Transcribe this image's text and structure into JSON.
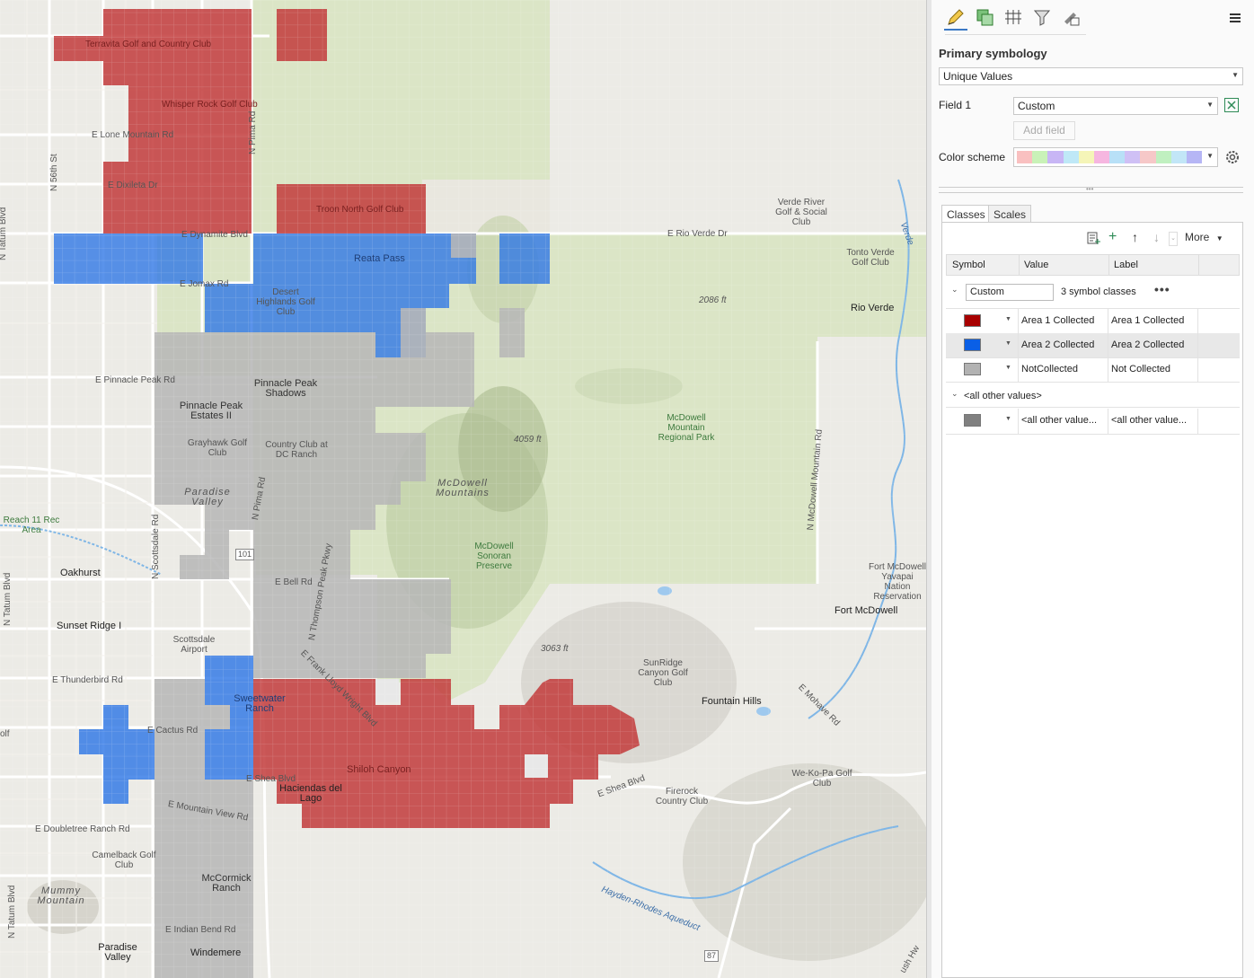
{
  "map": {
    "labels": {
      "terravita": "Terravita Golf and Country Club",
      "whisper_rock": "Whisper Rock Golf Club",
      "lone_mountain": "E Lone Mountain Rd",
      "dixileta": "E Dixileta Dr",
      "n56th": "N 56th St",
      "n_pima_top": "N Pima Rd",
      "n_tatum_top": "N Tatum Blvd",
      "troon": "Troon North Golf Club",
      "dynamite": "E Dynamite Blvd",
      "rio_verde_dr": "E Rio Verde Dr",
      "reata": "Reata Pass",
      "jomax": "E Jomax Rd",
      "desert_highlands": "Desert Highlands Golf Club",
      "verde_river_golf": "Verde River Golf & Social Club",
      "tonto_verde": "Tonto Verde Golf Club",
      "rio_verde": "Rio Verde",
      "elev_2086": "2086 ft",
      "verde_river": "Verde",
      "pinnacle_peak_rd": "E Pinnacle Peak Rd",
      "pinnacle_peak_shadows": "Pinnacle Peak Shadows",
      "pinnacle_peak_estates": "Pinnacle Peak Estates II",
      "grayhawk": "Grayhawk Golf Club",
      "country_club_dc": "Country Club at DC Ranch",
      "paradise_valley_italic": "Paradise Valley",
      "n_pima_mid": "N Pima Rd",
      "elev_4059": "4059 ft",
      "mcdowell_mountains": "McDowell Mountains",
      "mcdowell_park": "McDowell Mountain Regional Park",
      "mcdowell_mtn_rd": "N McDowell Mountain Rd",
      "mcdowell_sonoran": "McDowell Sonoran Preserve",
      "reach11": "Reach 11 Rec Area",
      "scottsdale_rd": "N Scottsdale Rd",
      "oakhurst": "Oakhurst",
      "hwy101": "101",
      "bell_rd": "E Bell Rd",
      "thompson_peak": "N Thompson Peak Pkwy",
      "tatum_mid": "N Tatum Blvd",
      "sunset_ridge": "Sunset Ridge I",
      "scottsdale_airport": "Scottsdale Airport",
      "fort_mcdowell_res": "Fort McDowell Yavapai Nation Reservation",
      "fort_mcdowell": "Fort McDowell",
      "elev_3063": "3063 ft",
      "sunridge": "SunRidge Canyon Golf Club",
      "frank_lloyd": "E Frank Lloyd Wright Blvd",
      "thunderbird": "E Thunderbird Rd",
      "sweetwater": "Sweetwater Ranch",
      "fountain_hills": "Fountain Hills",
      "mohave": "E Mohave Rd",
      "cactus": "E Cactus Rd",
      "shea_left": "E Shea Blvd",
      "shiloh": "Shiloh Canyon",
      "haciendas": "Haciendas del Lago",
      "wekopa": "We-Ko-Pa Golf Club",
      "shea_right": "E Shea Blvd",
      "firerock": "Firerock Country Club",
      "mountain_view": "E Mountain View Rd",
      "doubletree": "E Doubletree Ranch Rd",
      "camelback": "Camelback Golf Club",
      "mccormick": "McCormick Ranch",
      "mummy": "Mummy Mountain",
      "tatum_low": "N Tatum Blvd",
      "indian_bend": "E Indian Bend Rd",
      "paradise_valley": "Paradise Valley",
      "windemere": "Windemere",
      "hayden": "Hayden-Rhodes Aqueduct",
      "hwy87": "87",
      "olf": "olf",
      "ush": "ush Hw"
    }
  },
  "panel": {
    "tool_icons": [
      "symbology-pen-icon",
      "vary-symbology-icon",
      "label-grid-icon",
      "filter-icon",
      "attribute-pen-icon"
    ],
    "menu_icon": "hamburger-menu-icon",
    "primary_symbology_title": "Primary symbology",
    "renderer": "Unique Values",
    "field1_label": "Field 1",
    "field1_value": "Custom",
    "add_field_label": "Add field",
    "color_scheme_label": "Color scheme",
    "color_scheme_colors": [
      "#f9c0c0",
      "#c9f2b8",
      "#c8b6f5",
      "#bfe8f7",
      "#f5f5b8",
      "#f6b6e0",
      "#b8e0f7",
      "#cfc0f5",
      "#f6c8c8",
      "#c0f0c0",
      "#c2e6f7",
      "#b6b6f5"
    ],
    "tabs": [
      "Classes",
      "Scales"
    ],
    "more_label": "More",
    "columns": [
      "Symbol",
      "Value",
      "Label"
    ],
    "group_name": "Custom",
    "group_count": "3 symbol classes",
    "classes": [
      {
        "color": "#a80000",
        "value": "Area 1 Collected",
        "label": "Area 1 Collected"
      },
      {
        "color": "#0a5fe6",
        "value": "Area 2 Collected",
        "label": "Area 2 Collected"
      },
      {
        "color": "#b2b2b2",
        "value": "NotCollected",
        "label": "Not Collected"
      }
    ],
    "other_group": "<all other values>",
    "other_row": {
      "color": "#808080",
      "value": "<all other value...",
      "label": "<all other value..."
    }
  }
}
